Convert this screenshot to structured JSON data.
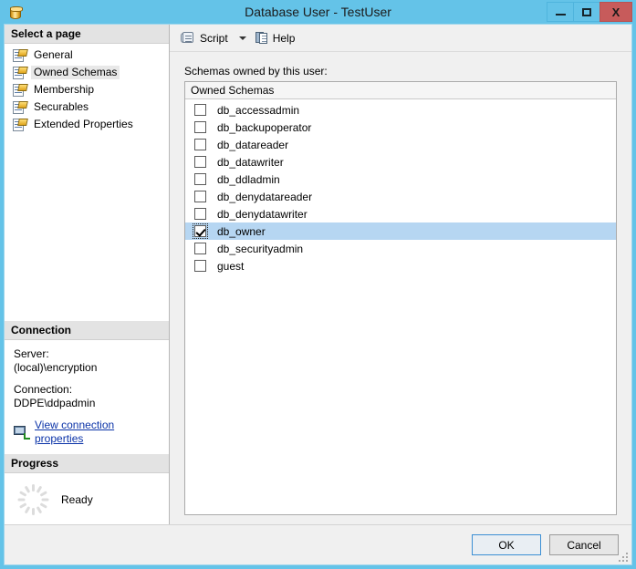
{
  "window": {
    "title": "Database User - TestUser",
    "icon": "database-icon",
    "buttons": {
      "minimize": "minimize-icon",
      "maximize": "maximize-icon",
      "close": "X"
    }
  },
  "sidebar": {
    "select_page_header": "Select a page",
    "items": [
      {
        "label": "General",
        "selected": false
      },
      {
        "label": "Owned Schemas",
        "selected": true
      },
      {
        "label": "Membership",
        "selected": false
      },
      {
        "label": "Securables",
        "selected": false
      },
      {
        "label": "Extended Properties",
        "selected": false
      }
    ],
    "connection": {
      "header": "Connection",
      "server_label": "Server:",
      "server_value": "(local)\\encryption",
      "connection_label": "Connection:",
      "connection_value": "DDPE\\ddpadmin",
      "link": "View connection properties"
    },
    "progress": {
      "header": "Progress",
      "status": "Ready"
    }
  },
  "toolbar": {
    "script_label": "Script",
    "help_label": "Help"
  },
  "main": {
    "field_label": "Schemas owned by this user:",
    "grid_header": "Owned Schemas",
    "rows": [
      {
        "name": "db_accessadmin",
        "checked": false,
        "selected": false
      },
      {
        "name": "db_backupoperator",
        "checked": false,
        "selected": false
      },
      {
        "name": "db_datareader",
        "checked": false,
        "selected": false
      },
      {
        "name": "db_datawriter",
        "checked": false,
        "selected": false
      },
      {
        "name": "db_ddladmin",
        "checked": false,
        "selected": false
      },
      {
        "name": "db_denydatareader",
        "checked": false,
        "selected": false
      },
      {
        "name": "db_denydatawriter",
        "checked": false,
        "selected": false
      },
      {
        "name": "db_owner",
        "checked": true,
        "selected": true
      },
      {
        "name": "db_securityadmin",
        "checked": false,
        "selected": false
      },
      {
        "name": "guest",
        "checked": false,
        "selected": false
      }
    ]
  },
  "footer": {
    "ok_label": "OK",
    "cancel_label": "Cancel"
  },
  "colors": {
    "title_bar": "#64c3e8",
    "close_button": "#c75b5b",
    "row_selected": "#b6d6f2",
    "link": "#0b33a8",
    "section_header": "#e3e3e3"
  }
}
